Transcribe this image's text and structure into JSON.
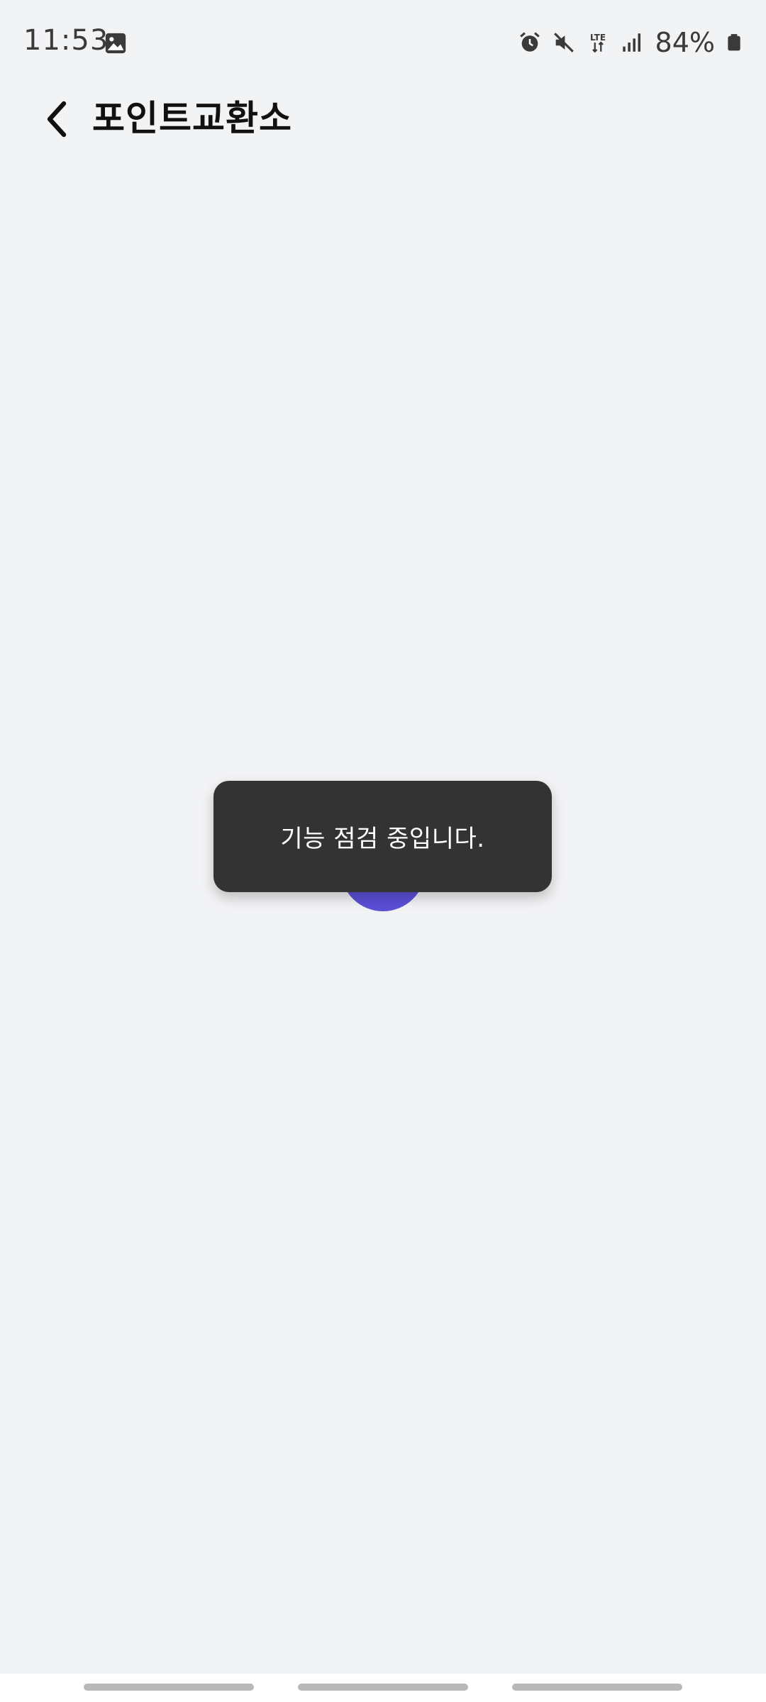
{
  "status_bar": {
    "time": "11:53",
    "battery": "84%",
    "icons": [
      "gallery-icon",
      "alarm-icon",
      "mute-icon",
      "lte-icon",
      "signal-icon",
      "battery-icon"
    ]
  },
  "header": {
    "title": "포인트교환소",
    "back_icon": "chevron-left-icon"
  },
  "toast": {
    "message": "기능 점검 중입니다."
  },
  "nav": {
    "buttons": [
      "recents-button",
      "home-button",
      "back-nav-button"
    ]
  },
  "colors": {
    "background": "#f2f3f5",
    "toast_background": "#333333",
    "spinner": "#5b4fd6"
  }
}
